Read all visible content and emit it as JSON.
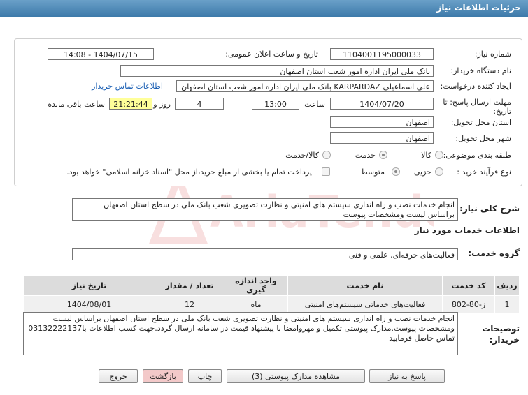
{
  "header": {
    "title": "جزئیات اطلاعات نیاز"
  },
  "fields": {
    "need_number_label": "شماره نیاز:",
    "need_number": "1104001195000033",
    "announce_label": "تاریخ و ساعت اعلان عمومی:",
    "announce_value": "1404/07/15 - 14:08",
    "buyer_label": "نام دستگاه خریدار:",
    "buyer_value": "بانک ملی ایران اداره امور شعب استان اصفهان",
    "creator_label": "ایجاد کننده درخواست:",
    "creator_value": "علی اسماعیلی KARPARDAZ بانک ملی ایران اداره امور شعب استان اصفهان",
    "contact_link": "اطلاعات تماس خریدار",
    "deadline_label": "مهلت ارسال پاسخ: تا",
    "deadline_label2": "تاریخ:",
    "deadline_date": "1404/07/20",
    "time_label": "ساعت",
    "deadline_time": "13:00",
    "days_value": "4",
    "days_label": "روز و",
    "remaining_time": "21:21:44",
    "remaining_label": "ساعت باقی مانده",
    "province_label": "استان محل تحویل:",
    "province_value": "اصفهان",
    "city_label": "شهر محل تحویل:",
    "city_value": "اصفهان",
    "category_label": "طبقه بندی موضوعی:",
    "category_options": [
      "کالا",
      "خدمت",
      "کالا/خدمت"
    ],
    "category_selected": "خدمت",
    "process_label": "نوع فرآیند خرید :",
    "process_options": [
      "جزیی",
      "متوسط"
    ],
    "process_selected": "متوسط",
    "payment_note": "پرداخت تمام یا بخشی از مبلغ خرید،از محل \"اسناد خزانه اسلامی\" خواهد بود."
  },
  "summary": {
    "label": "شرح کلی نیاز:",
    "text": "انجام خدمات نصب و راه اندازی سیستم های امنیتی و نظارت تصویری شعب بانک ملی در سطح استان اصفهان براساس لیست ومشخصات پیوست"
  },
  "services": {
    "section_title": "اطلاعات خدمات مورد نیاز",
    "group_label": "گروه خدمت:",
    "group_value": "فعالیت‌های حرفه‌ای، علمی و فنی",
    "columns": [
      "ردیف",
      "کد خدمت",
      "نام خدمت",
      "واحد اندازه گیری",
      "تعداد / مقدار",
      "تاریخ نیاز"
    ],
    "rows": [
      [
        "1",
        "ز-80-802",
        "فعالیت‌های خدماتی سیستم‌های امنیتی",
        "ماه",
        "12",
        "1404/08/01"
      ]
    ]
  },
  "buyer_notes": {
    "label_line1": "توضیحات",
    "label_line2": "خریدار:",
    "text": "انجام خدمات نصب و راه اندازی سیستم های امنیتی و نظارت تصویری شعب بانک ملی در سطح استان اصفهان براساس لیست ومشخصات پیوست.مدارک پیوستی تکمیل و مهروامضا با پیشنهاد قیمت در سامانه ارسال گردد.جهت کسب اطلاعات با03132222137 تماس حاصل فرمایید"
  },
  "buttons": {
    "reply": "پاسخ به نیاز",
    "attachments": "مشاهده مدارک پیوستی (3)",
    "print": "چاپ",
    "back": "بازگشت",
    "exit": "خروج"
  },
  "watermark": {
    "text": "AriaTender.net"
  },
  "colors": {
    "title_bar": "#4a87b6",
    "remaining_bg": "#ffff99",
    "link": "#1a5fb4",
    "exit_bg": "#f3c9c9"
  }
}
